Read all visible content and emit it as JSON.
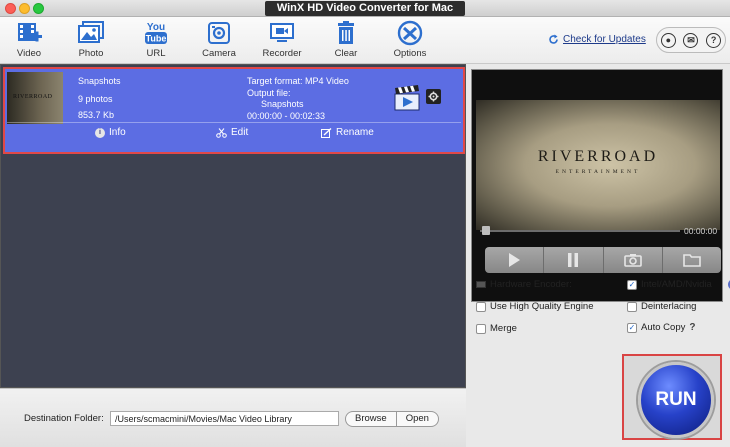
{
  "window": {
    "title": "WinX HD Video Converter for Mac"
  },
  "toolbar": {
    "items": [
      {
        "label": "Video",
        "icon": "add-video-icon"
      },
      {
        "label": "Photo",
        "icon": "photo-icon"
      },
      {
        "label": "URL",
        "icon": "youtube-icon"
      },
      {
        "label": "Camera",
        "icon": "camera-icon"
      },
      {
        "label": "Recorder",
        "icon": "screen-recorder-icon"
      },
      {
        "label": "Clear",
        "icon": "trash-icon"
      },
      {
        "label": "Options",
        "icon": "options-tools-icon"
      }
    ],
    "check_updates": "Check for Updates"
  },
  "file_list": {
    "items": [
      {
        "name": "Snapshots",
        "count": "9 photos",
        "size": "853.7 Kb",
        "target_format": "Target format: MP4 Video",
        "output_label": "Output file:",
        "output_name": "Snapshots",
        "time_range": "00:00:00 - 00:02:33",
        "actions": {
          "info": "Info",
          "edit": "Edit",
          "rename": "Rename"
        },
        "thumb_text": "RIVERROAD"
      }
    ]
  },
  "bottom": {
    "dest_label": "Destination Folder:",
    "dest_path": "/Users/scmacmini/Movies/Mac Video Library",
    "browse": "Browse",
    "open": "Open"
  },
  "preview": {
    "brand": "RIVERROAD",
    "brand_sub": "ENTERTAINMENT",
    "time": "00:00:00"
  },
  "options": {
    "hw_encoder": "Hardware Encoder:",
    "intel": "Intel/AMD/Nvidia",
    "intel_checked": true,
    "high_quality": "Use High Quality Engine",
    "high_quality_checked": false,
    "deinterlacing": "Deinterlacing",
    "deinterlacing_checked": false,
    "merge": "Merge",
    "merge_checked": false,
    "auto_copy": "Auto Copy",
    "auto_copy_checked": true
  },
  "run": {
    "label": "RUN"
  },
  "colors": {
    "item_bg": "#5c6de3",
    "accent": "#2468c9",
    "highlight_border": "#e04848"
  }
}
